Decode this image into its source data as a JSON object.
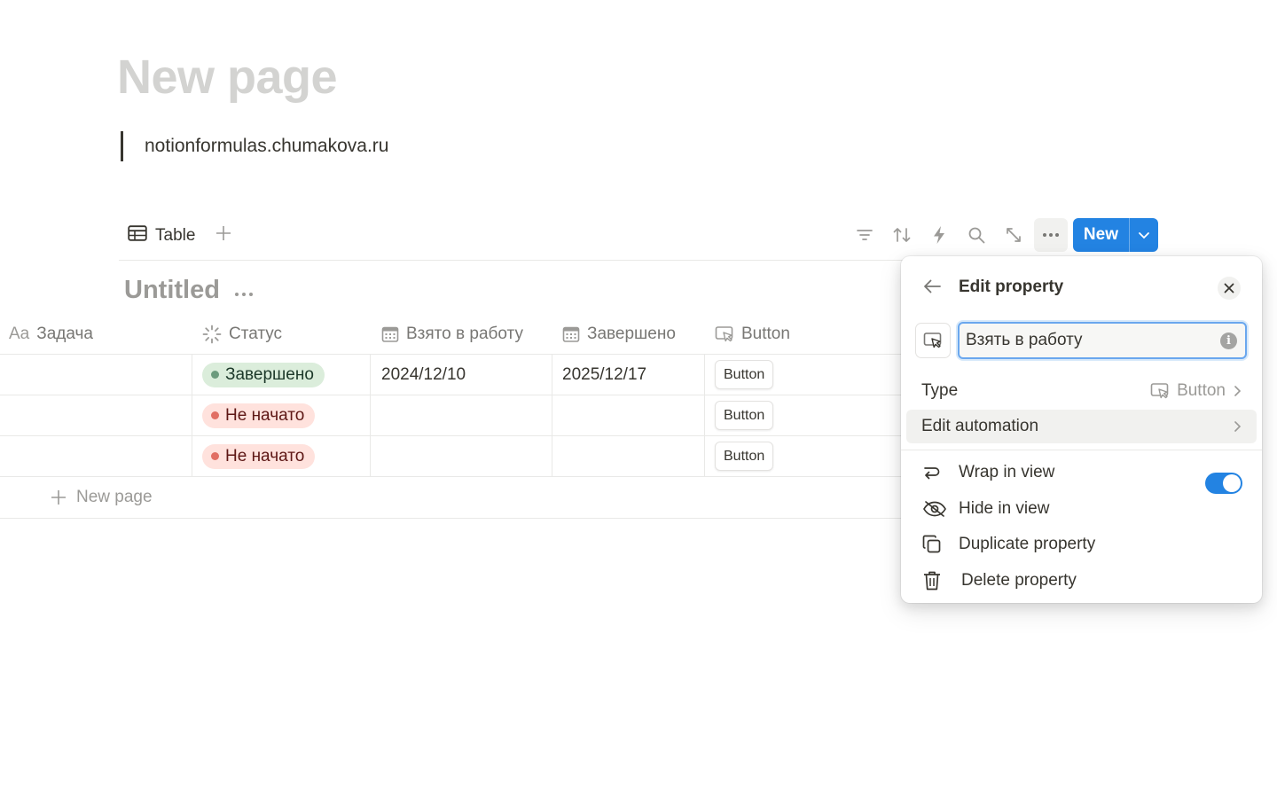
{
  "page": {
    "title": "New page",
    "quote": "notionformulas.chumakova.ru"
  },
  "view": {
    "tab_label": "Table",
    "new_label": "New",
    "tools": [
      "filter-icon",
      "sort-icon",
      "automation-icon",
      "search-icon",
      "expand-icon",
      "more-icon"
    ]
  },
  "database": {
    "title": "Untitled",
    "columns": [
      {
        "label": "Задача",
        "prefix": "Aa",
        "icon": "title-icon"
      },
      {
        "label": "Статус",
        "icon": "status-icon"
      },
      {
        "label": "Взято в работу",
        "icon": "calendar-icon"
      },
      {
        "label": "Завершено",
        "icon": "calendar-icon"
      },
      {
        "label": "Button",
        "icon": "button-icon"
      }
    ],
    "rows": [
      {
        "task": "",
        "status": "Завершено",
        "status_kind": "done",
        "taken": "2024/12/10",
        "completed": "2025/12/17",
        "button": "Button"
      },
      {
        "task": "",
        "status": "Не начато",
        "status_kind": "todo",
        "taken": "",
        "completed": "",
        "button": "Button"
      },
      {
        "task": "",
        "status": "Не начато",
        "status_kind": "todo",
        "taken": "",
        "completed": "",
        "button": "Button"
      }
    ],
    "new_row_label": "New page"
  },
  "panel": {
    "title": "Edit property",
    "property_name": "Взять в работу",
    "type_label": "Type",
    "type_value": "Button",
    "edit_automation": "Edit automation",
    "menu": {
      "wrap": "Wrap in view",
      "wrap_enabled": true,
      "hide": "Hide in view",
      "duplicate": "Duplicate property",
      "delete": "Delete property"
    }
  },
  "colors": {
    "accent": "#2383e2",
    "done_bg": "#dbeddb",
    "todo_bg": "#ffe2dd"
  }
}
